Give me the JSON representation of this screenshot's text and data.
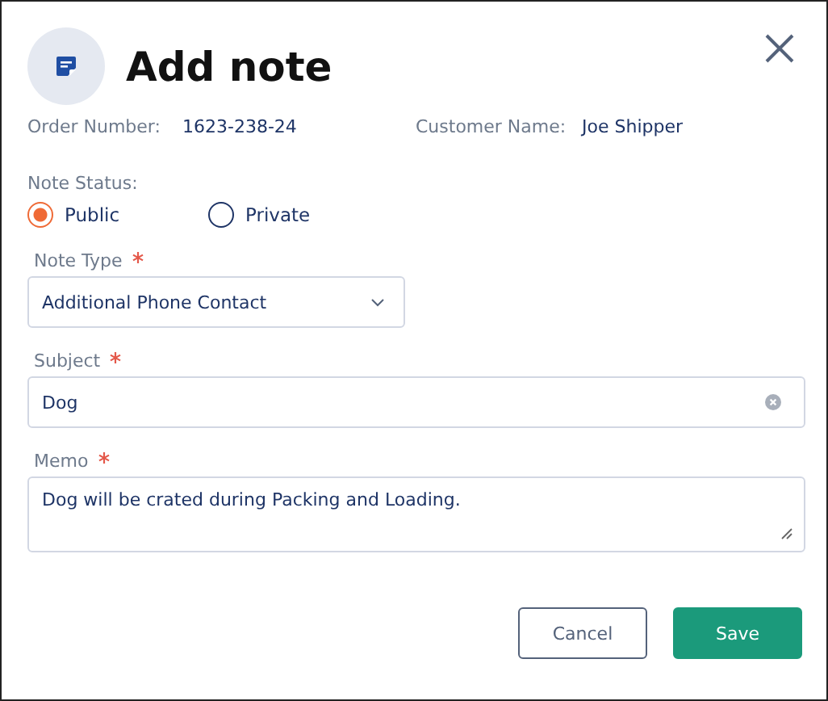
{
  "dialog": {
    "title": "Add note"
  },
  "info": [
    {
      "label": "Order Number:",
      "value": "1623-238-24"
    },
    {
      "label": "Customer Name:",
      "value": "Joe Shipper"
    }
  ],
  "note_status": {
    "label": "Note Status:",
    "options": [
      {
        "label": "Public",
        "selected": true
      },
      {
        "label": "Private",
        "selected": false
      }
    ]
  },
  "fields": [
    {
      "kind": "select",
      "label": "Note Type",
      "required": true,
      "value": "Additional Phone Contact"
    },
    {
      "kind": "text",
      "label": "Subject",
      "required": true,
      "value": "Dog"
    },
    {
      "kind": "textarea",
      "label": "Memo",
      "required": true,
      "value": "Dog will be crated during Packing and Loading."
    }
  ],
  "buttons": [
    {
      "label": "Cancel",
      "kind": "secondary"
    },
    {
      "label": "Save",
      "kind": "primary"
    }
  ]
}
